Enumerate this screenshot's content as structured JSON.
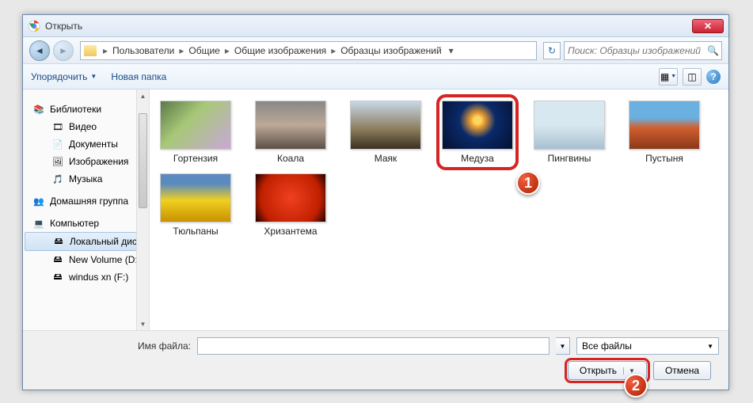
{
  "window": {
    "title": "Открыть"
  },
  "breadcrumbs": [
    "Пользователи",
    "Общие",
    "Общие изображения",
    "Образцы изображений"
  ],
  "search": {
    "placeholder": "Поиск: Образцы изображений"
  },
  "toolbar": {
    "organize": "Упорядочить",
    "new_folder": "Новая папка"
  },
  "sidebar": {
    "libraries": "Библиотеки",
    "items": [
      {
        "icon": "🎞",
        "label": "Видео"
      },
      {
        "icon": "📄",
        "label": "Документы"
      },
      {
        "icon": "🖼",
        "label": "Изображения"
      },
      {
        "icon": "🎵",
        "label": "Музыка"
      }
    ],
    "homegroup": "Домашняя группа",
    "computer": "Компьютер",
    "drives": [
      {
        "label": "Локальный диск"
      },
      {
        "label": "New Volume (D:)"
      },
      {
        "label": "windus xn (F:)"
      }
    ]
  },
  "files": [
    {
      "name": "Гортензия",
      "bg": "linear-gradient(135deg,#5a7a4a,#a8c878 40%,#c8a8d8)"
    },
    {
      "name": "Коала",
      "bg": "linear-gradient(#888,#bda896 50%,#5a5048)"
    },
    {
      "name": "Маяк",
      "bg": "linear-gradient(#c8d8e8,#8a7a5a 60%,#3a3020)"
    },
    {
      "name": "Медуза",
      "bg": "radial-gradient(circle at 50% 40%,#f8d860 8%,#f0a030 15%,#0a2a6a 40%,#041030)",
      "selected": true
    },
    {
      "name": "Пингвины",
      "bg": "linear-gradient(#d8e8f0 50%,#a8c0d0)"
    },
    {
      "name": "Пустыня",
      "bg": "linear-gradient(#6ab0e0 35%,#d06030 55%,#8a3818)"
    },
    {
      "name": "Тюльпаны",
      "bg": "linear-gradient(#5a8ac0 20%,#f0d020 55%,#c89000)"
    },
    {
      "name": "Хризантема",
      "bg": "radial-gradient(circle,#f04020,#c02000 70%,#200000)"
    }
  ],
  "footer": {
    "filename_label": "Имя файла:",
    "filetype": "Все файлы",
    "open": "Открыть",
    "cancel": "Отмена"
  },
  "markers": {
    "m1": "1",
    "m2": "2"
  }
}
